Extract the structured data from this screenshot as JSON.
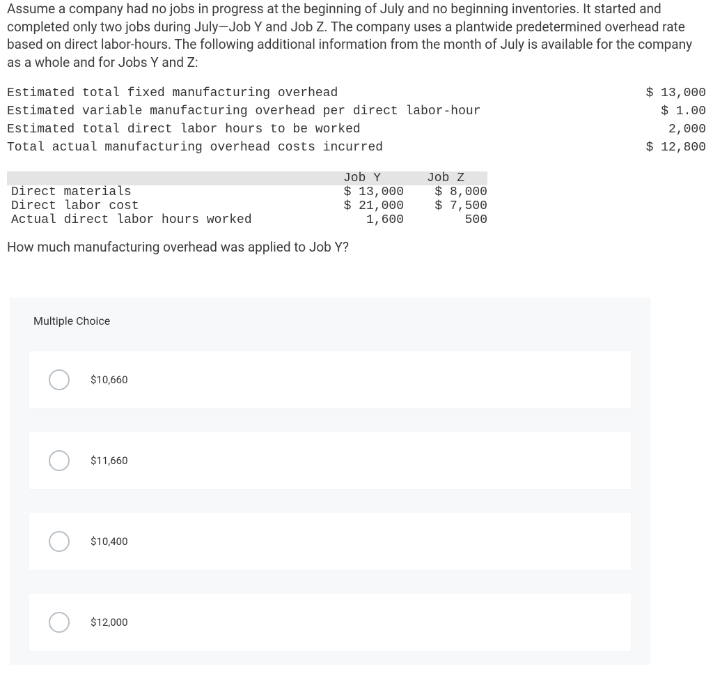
{
  "intro": "Assume a company had no jobs in progress at the beginning of July and no beginning inventories. It started and completed only two jobs during July—Job Y and Job Z. The company uses a plantwide predetermined overhead rate based on direct labor-hours. The following additional information from the month of July is available for the company as a whole and for Jobs Y and Z:",
  "overhead": {
    "rows": [
      {
        "label": "Estimated total fixed manufacturing overhead",
        "value": "$ 13,000"
      },
      {
        "label": "Estimated variable manufacturing overhead per direct labor-hour",
        "value": "$ 1.00"
      },
      {
        "label": "Estimated total direct labor hours to be worked",
        "value": "2,000"
      },
      {
        "label": "Total actual manufacturing overhead costs incurred",
        "value": "$ 12,800"
      }
    ]
  },
  "jobs": {
    "headers": {
      "y": "Job Y",
      "z": "Job Z"
    },
    "rows": [
      {
        "label": "Direct materials",
        "y": "$ 13,000",
        "z": "$ 8,000"
      },
      {
        "label": "Direct labor cost",
        "y": "$ 21,000",
        "z": "$ 7,500"
      },
      {
        "label": "Actual direct labor hours worked",
        "y": "1,600",
        "z": "500"
      }
    ]
  },
  "question": "How much manufacturing overhead was applied to Job Y?",
  "mc": {
    "title": "Multiple Choice",
    "options": [
      {
        "label": "$10,660"
      },
      {
        "label": "$11,660"
      },
      {
        "label": "$10,400"
      },
      {
        "label": "$12,000"
      }
    ]
  }
}
